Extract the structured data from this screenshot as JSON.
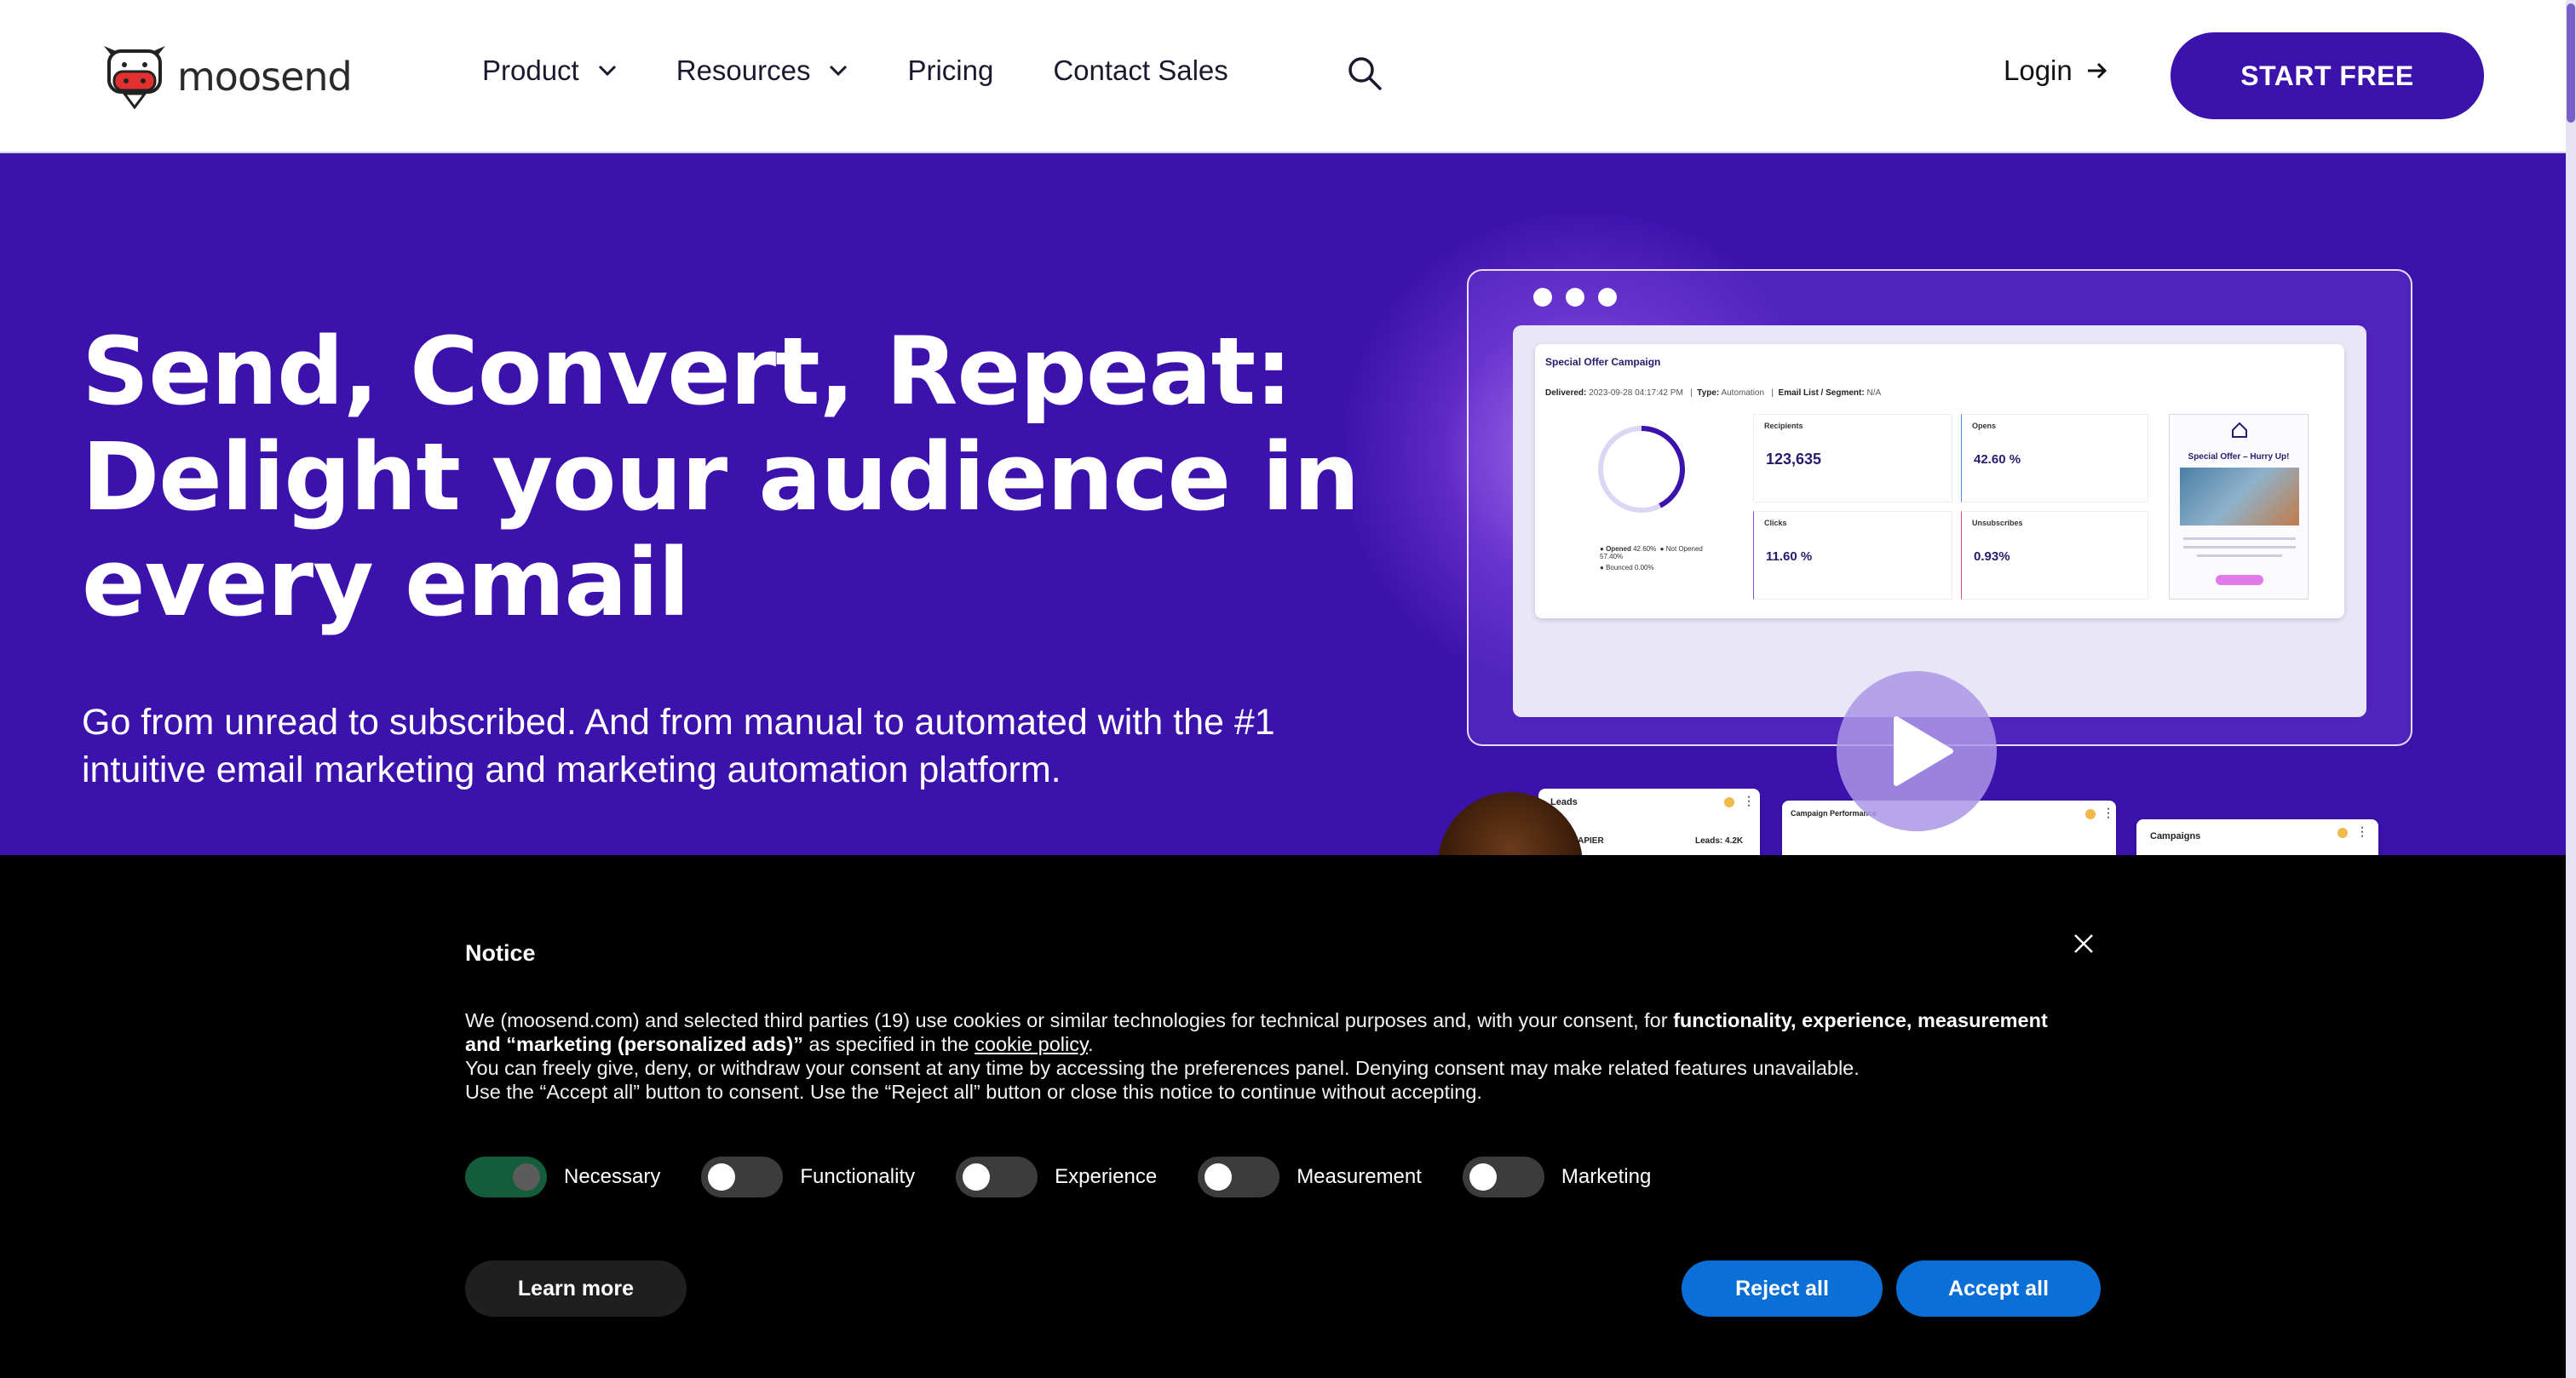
{
  "header": {
    "logo_text": "moosend",
    "nav": [
      {
        "label": "Product",
        "has_dropdown": true
      },
      {
        "label": "Resources",
        "has_dropdown": true
      },
      {
        "label": "Pricing",
        "has_dropdown": false
      },
      {
        "label": "Contact Sales",
        "has_dropdown": false
      }
    ],
    "login_label": "Login",
    "start_label": "START FREE"
  },
  "hero": {
    "title_line1": "Send, Convert, Repeat:",
    "title_line2": "Delight your audience in",
    "title_line3": "every email",
    "subtitle": "Go from unread to subscribed. And from manual to automated with the #1 intuitive email marketing and marketing automation platform."
  },
  "dashboard": {
    "campaign_title": "Special Offer Campaign",
    "delivered_label": "Delivered:",
    "delivered_value": "2023-09-28 04:17:42 PM",
    "type_label": "Type:",
    "type_value": "Automation",
    "list_label": "Email List / Segment:",
    "list_value": "N/A",
    "legend": {
      "opened": "Opened",
      "opened_value": "42.60%",
      "not_opened": "Not Opened",
      "not_opened_value": "57.40%",
      "bounced": "Bounced",
      "bounced_value": "0.00%"
    },
    "stats": [
      {
        "label": "Recipients",
        "value": "123,635"
      },
      {
        "label": "Opens",
        "value": "42.60 %"
      },
      {
        "label": "Clicks",
        "value": "11.60 %"
      },
      {
        "label": "Unsubscribes",
        "value": "0.93%"
      }
    ],
    "email_preview_title": "Special Offer – Hurry Up!",
    "widgets": {
      "leads": "Leads",
      "leads_source": "ZAPIER",
      "leads_count": "Leads: 4.2K",
      "performance": "Campaign Performance",
      "campaigns": "Campaigns"
    }
  },
  "notice": {
    "title": "Notice",
    "text_part1": "We (moosend.com) and selected third parties (19) use cookies or similar technologies for technical purposes and, with your consent, for ",
    "text_bold": "functionality, experience, measurement and “marketing (personalized ads)”",
    "text_part2": " as specified in the ",
    "cookie_link": "cookie policy",
    "text_part3": ".",
    "line2": "You can freely give, deny, or withdraw your consent at any time by accessing the preferences panel. Denying consent may make related features unavailable.",
    "line3": "Use the “Accept all” button to consent. Use the “Reject all” button or close this notice to continue without accepting.",
    "toggles": [
      {
        "label": "Necessary",
        "on": true
      },
      {
        "label": "Functionality",
        "on": false
      },
      {
        "label": "Experience",
        "on": false
      },
      {
        "label": "Measurement",
        "on": false
      },
      {
        "label": "Marketing",
        "on": false
      }
    ],
    "learn_more": "Learn more",
    "reject_all": "Reject all",
    "accept_all": "Accept all"
  },
  "colors": {
    "brand": "#3c12ad",
    "notice_bg": "#000000",
    "consent_button": "#0a6fd6",
    "toggle_on": "#145c3b"
  }
}
